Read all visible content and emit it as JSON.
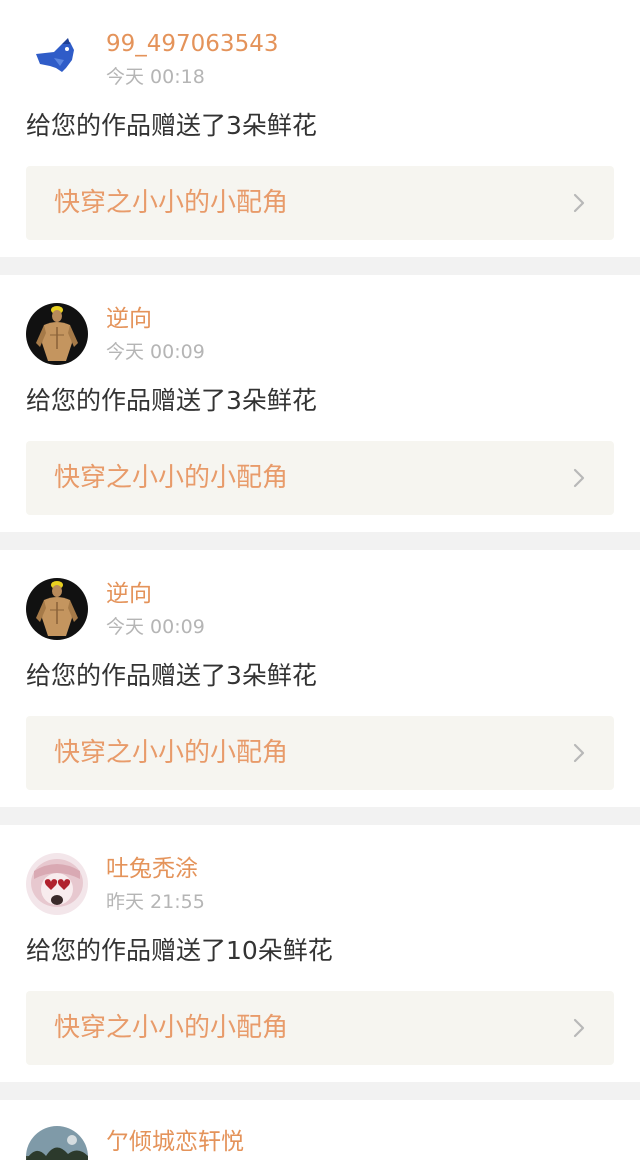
{
  "notifications": [
    {
      "username": "99_497063543",
      "time": "今天 00:18",
      "message": "给您的作品赠送了3朵鲜花",
      "work_title": "快穿之小小的小配角",
      "avatar_icon": "blue-bird-avatar"
    },
    {
      "username": "逆向",
      "time": "今天 00:09",
      "message": "给您的作品赠送了3朵鲜花",
      "work_title": "快穿之小小的小配角",
      "avatar_icon": "muscle-man-avatar"
    },
    {
      "username": "逆向",
      "time": "今天 00:09",
      "message": "给您的作品赠送了3朵鲜花",
      "work_title": "快穿之小小的小配角",
      "avatar_icon": "muscle-man-avatar"
    },
    {
      "username": "吐兔秃涂",
      "time": "昨天 21:55",
      "message": "给您的作品赠送了10朵鲜花",
      "work_title": "快穿之小小的小配角",
      "avatar_icon": "anime-girl-avatar"
    },
    {
      "username": "亇倾城恋轩悦",
      "avatar_icon": "landscape-avatar"
    }
  ],
  "colors": {
    "username": "#e4935a",
    "time": "#b5b5b5",
    "message": "#333333",
    "work_title": "#e89b6a",
    "work_bg": "#f6f5f0",
    "separator": "#f2f2f2"
  }
}
